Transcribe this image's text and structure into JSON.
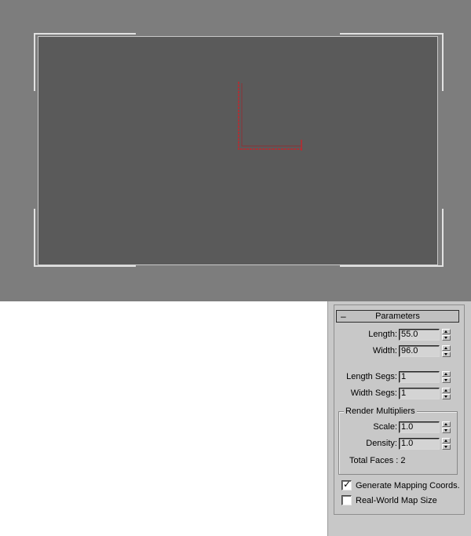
{
  "viewport": {
    "background": "#7d7d7d",
    "frame_color": "#5a5a5a",
    "gizmo_color": "#c0282d"
  },
  "parameters": {
    "rollout_toggle": "–",
    "rollout_title": "Parameters",
    "length_label": "Length:",
    "length_value": "55.0",
    "width_label": "Width:",
    "width_value": "96.0",
    "length_segs_label": "Length Segs:",
    "length_segs_value": "1",
    "width_segs_label": "Width Segs:",
    "width_segs_value": "1"
  },
  "render_multipliers": {
    "title": "Render Multipliers",
    "scale_label": "Scale:",
    "scale_value": "1.0",
    "density_label": "Density:",
    "density_value": "1.0",
    "total_faces": "Total Faces : 2"
  },
  "options": {
    "generate_mapping_label": "Generate Mapping Coords.",
    "generate_mapping_checked": true,
    "real_world_label": "Real-World Map Size",
    "real_world_checked": false
  }
}
